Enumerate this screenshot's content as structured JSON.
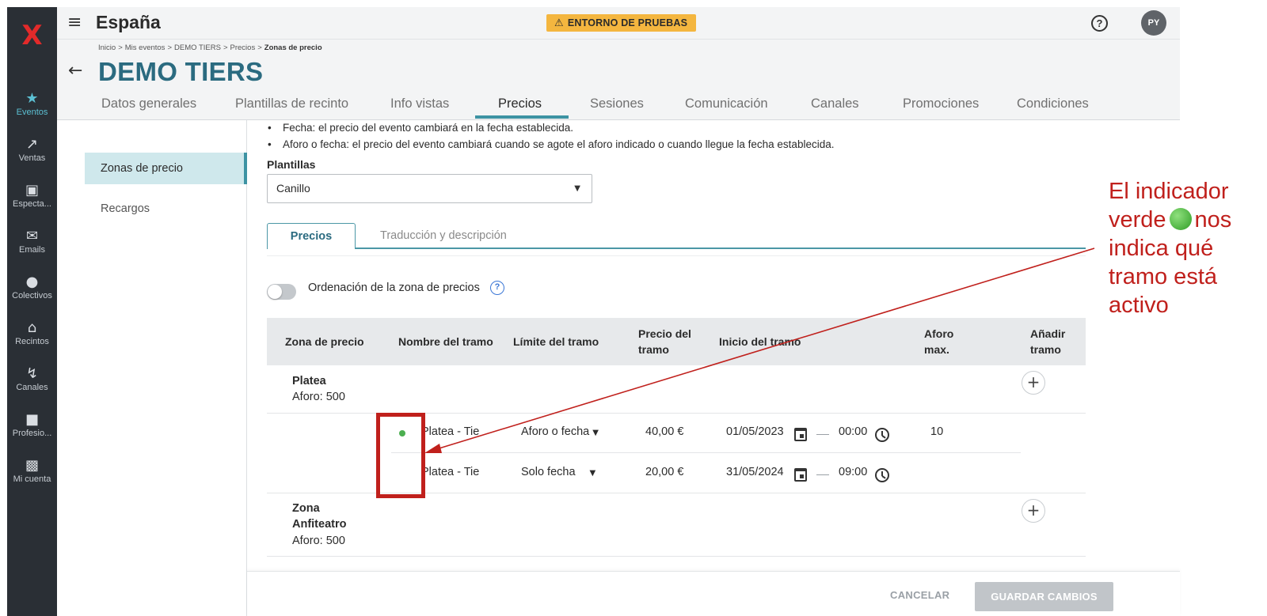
{
  "app": {
    "country": "España",
    "environment_badge": "ENTORNO DE PRUEBAS",
    "help_label": "?",
    "avatar_initials": "PY"
  },
  "leftnav": {
    "items": [
      {
        "label": "Eventos",
        "icon": "calendar-star-icon",
        "active": true
      },
      {
        "label": "Ventas",
        "icon": "trend-up-icon"
      },
      {
        "label": "Especta...",
        "icon": "seat-icon"
      },
      {
        "label": "Emails",
        "icon": "mail-icon"
      },
      {
        "label": "Colectivos",
        "icon": "group-icon"
      },
      {
        "label": "Recintos",
        "icon": "venue-icon"
      },
      {
        "label": "Canales",
        "icon": "channels-icon"
      },
      {
        "label": "Profesio...",
        "icon": "briefcase-icon"
      },
      {
        "label": "Mi cuenta",
        "icon": "account-icon"
      }
    ]
  },
  "breadcrumb": {
    "items": [
      "Inicio",
      "Mis eventos",
      "DEMO TIERS",
      "Precios"
    ],
    "current": "Zonas de precio",
    "separator": ">"
  },
  "event": {
    "title": "DEMO TIERS"
  },
  "tabs": [
    "Datos generales",
    "Plantillas de recinto",
    "Info vistas",
    "Precios",
    "Sesiones",
    "Comunicación",
    "Canales",
    "Promociones",
    "Condiciones"
  ],
  "active_tab": "Precios",
  "subnav": {
    "items": [
      "Zonas de precio",
      "Recargos"
    ],
    "active": "Zonas de precio"
  },
  "content": {
    "bullets": [
      "Fecha: el precio del evento cambiará en la fecha establecida.",
      "Aforo o fecha: el precio del evento cambiará cuando se agote el aforo indicado o cuando llegue la fecha establecida."
    ],
    "plantillas_label": "Plantillas",
    "plantillas_value": "Canillo",
    "inner_tabs": [
      "Precios",
      "Traducción y descripción"
    ],
    "toggle_label": "Ordenación de la zona de precios",
    "toggle_on": false
  },
  "table": {
    "headers": {
      "zona": "Zona de precio",
      "nombre": "Nombre del tramo",
      "limite": "Límite del tramo",
      "precio": "Precio del tramo",
      "inicio": "Inicio del tramo",
      "aforo": "Aforo max.",
      "anadir": "Añadir tramo"
    },
    "zones": [
      {
        "name": "Platea",
        "aforo": "Aforo: 500",
        "tiers": [
          {
            "active": true,
            "name": "Platea - Tie",
            "limit": "Aforo o fecha",
            "price": "40,00 €",
            "date": "01/05/2023",
            "time": "00:00",
            "aforo_max": "10"
          },
          {
            "active": false,
            "name": "Platea - Tie",
            "limit": "Solo fecha",
            "price": "20,00 €",
            "date": "31/05/2024",
            "time": "09:00",
            "aforo_max": ""
          }
        ]
      },
      {
        "name": "Zona Anfiteatro",
        "aforo": "Aforo: 500",
        "tiers": []
      }
    ],
    "add_symbol": "+"
  },
  "footer": {
    "cancel": "CANCELAR",
    "save": "GUARDAR CAMBIOS"
  },
  "annotation": {
    "text_before": "El indicador verde",
    "text_after": "nos indica qué tramo está activo",
    "color": "#c0201c"
  }
}
